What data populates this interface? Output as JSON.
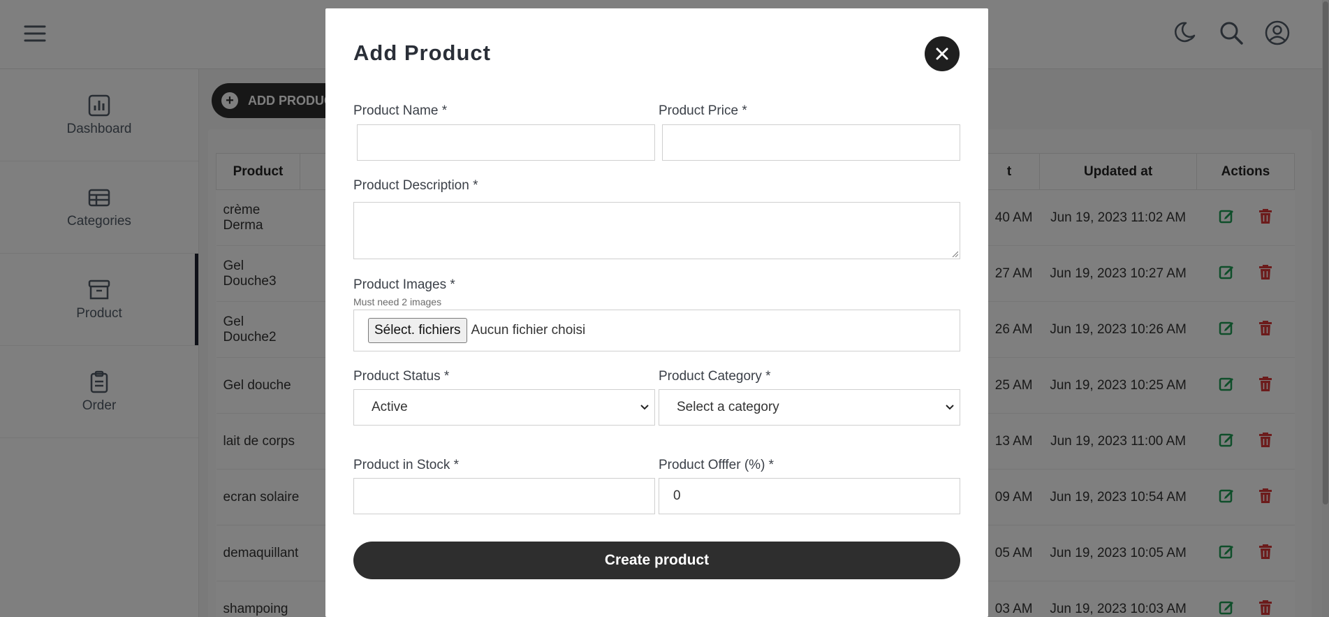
{
  "sidebar": {
    "items": [
      {
        "label": "Dashboard"
      },
      {
        "label": "Categories"
      },
      {
        "label": "Product"
      },
      {
        "label": "Order"
      }
    ]
  },
  "main": {
    "add_button_label": "ADD PRODUCT",
    "table": {
      "headers": [
        "Product",
        "t",
        "Updated at",
        "Actions"
      ],
      "rows": [
        {
          "product": "crème Derma",
          "created_tail": "40 AM",
          "updated": "Jun 19, 2023 11:02 AM"
        },
        {
          "product": "Gel Douche3",
          "created_tail": "27 AM",
          "updated": "Jun 19, 2023 10:27 AM"
        },
        {
          "product": "Gel Douche2",
          "created_tail": "26 AM",
          "updated": "Jun 19, 2023 10:26 AM"
        },
        {
          "product": "Gel douche",
          "created_tail": "25 AM",
          "updated": "Jun 19, 2023 10:25 AM"
        },
        {
          "product": "lait de corps",
          "created_tail": "13 AM",
          "updated": "Jun 19, 2023 11:00 AM"
        },
        {
          "product": "ecran solaire",
          "created_tail": "09 AM",
          "updated": "Jun 19, 2023 10:54 AM"
        },
        {
          "product": "demaquillant",
          "created_tail": "05 AM",
          "updated": "Jun 19, 2023 10:05 AM"
        },
        {
          "product": "shampoing",
          "created_tail": "03 AM",
          "updated": "Jun 19, 2023 10:03 AM"
        }
      ]
    }
  },
  "modal": {
    "title": "Add Product",
    "name_label": "Product Name *",
    "name_value": "",
    "price_label": "Product Price *",
    "price_value": "",
    "description_label": "Product Description *",
    "description_value": "",
    "images_label": "Product Images *",
    "images_hint": "Must need 2 images",
    "file_button_label": "Sélect. fichiers",
    "file_status": "Aucun fichier choisi",
    "status_label": "Product Status *",
    "status_value": "Active",
    "category_label": "Product Category *",
    "category_value": "Select a category",
    "stock_label": "Product in Stock *",
    "stock_value": "",
    "offer_label": "Product Offfer (%) *",
    "offer_value": "0",
    "submit_label": "Create product"
  },
  "colors": {
    "accent_dark": "#2e2e2e",
    "edit_green": "#1f9d55",
    "delete_red": "#d93636"
  },
  "icons": {
    "menu": "hamburger-icon",
    "theme": "moon-icon",
    "search": "search-icon",
    "account": "user-circle-icon",
    "dashboard": "chart-icon",
    "categories": "table-icon",
    "product": "archive-box-icon",
    "order": "clipboard-icon",
    "edit": "edit-icon",
    "delete": "trash-icon",
    "close": "close-icon"
  }
}
